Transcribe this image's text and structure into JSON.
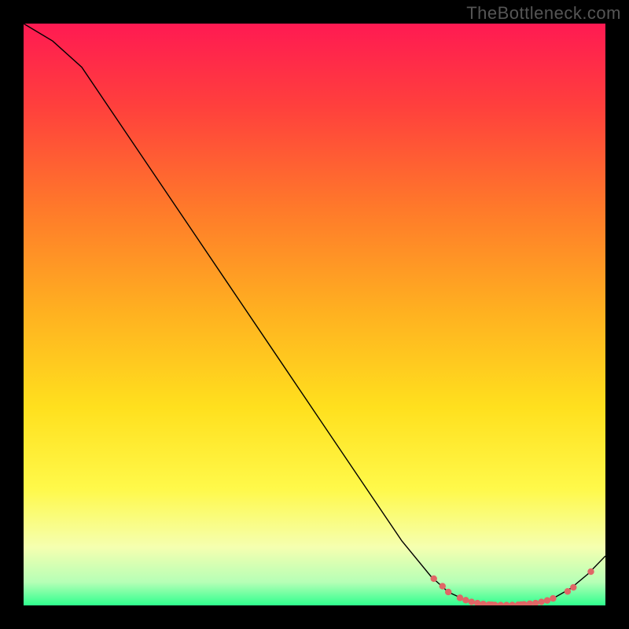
{
  "watermark": "TheBottleneck.com",
  "chart_data": {
    "type": "line",
    "title": "",
    "xlabel": "",
    "ylabel": "",
    "xlim": [
      0,
      100
    ],
    "ylim": [
      0,
      100
    ],
    "background_gradient": {
      "type": "vertical",
      "stops": [
        {
          "offset": 0.0,
          "color": "#ff1a52"
        },
        {
          "offset": 0.14,
          "color": "#ff3f3d"
        },
        {
          "offset": 0.32,
          "color": "#ff7a2a"
        },
        {
          "offset": 0.5,
          "color": "#ffb220"
        },
        {
          "offset": 0.66,
          "color": "#ffe01e"
        },
        {
          "offset": 0.8,
          "color": "#fff94a"
        },
        {
          "offset": 0.9,
          "color": "#f5ffb0"
        },
        {
          "offset": 0.96,
          "color": "#b6ffb6"
        },
        {
          "offset": 1.0,
          "color": "#2fff8e"
        }
      ]
    },
    "series": [
      {
        "name": "curve",
        "color": "#000000",
        "width": 1.4,
        "x": [
          0,
          5,
          10,
          15,
          20,
          25,
          30,
          35,
          40,
          45,
          50,
          55,
          60,
          65,
          70,
          73,
          76,
          79,
          82,
          85,
          88,
          91,
          94,
          97,
          100
        ],
        "y": [
          100,
          97,
          92.5,
          85.1,
          77.7,
          70.3,
          62.9,
          55.5,
          48.1,
          40.7,
          33.3,
          25.9,
          18.5,
          11.1,
          5.0,
          2.3,
          0.9,
          0.25,
          0.05,
          0.1,
          0.4,
          1.2,
          2.9,
          5.4,
          8.5
        ]
      }
    ],
    "points": {
      "color": "#e06666",
      "radius": 4.2,
      "x": [
        70.5,
        72.0,
        73.0,
        75.0,
        76.0,
        77.0,
        78.0,
        79.0,
        80.0,
        80.5,
        81.0,
        82.0,
        83.0,
        84.0,
        85.0,
        85.5,
        86.0,
        87.0,
        88.0,
        89.0,
        90.0,
        91.0,
        93.5,
        94.5,
        97.5
      ],
      "y": [
        4.6,
        3.3,
        2.3,
        1.3,
        0.9,
        0.6,
        0.4,
        0.25,
        0.15,
        0.1,
        0.08,
        0.05,
        0.05,
        0.07,
        0.1,
        0.15,
        0.2,
        0.3,
        0.4,
        0.6,
        0.85,
        1.2,
        2.4,
        3.1,
        5.8
      ]
    }
  }
}
